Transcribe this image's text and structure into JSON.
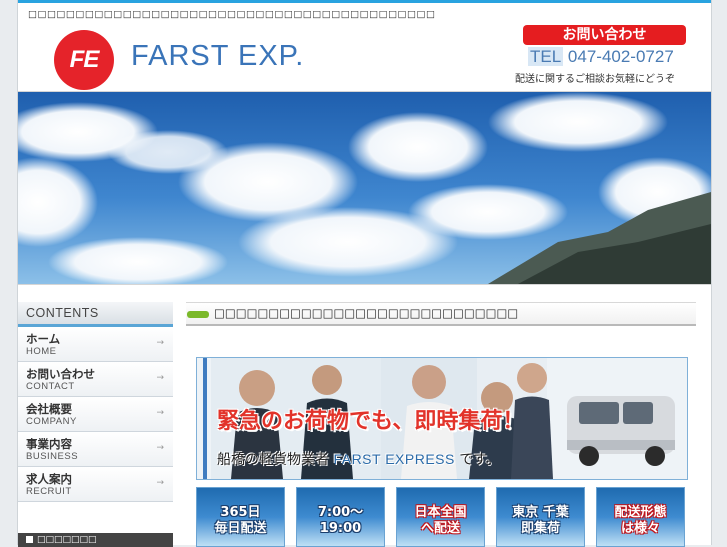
{
  "header": {
    "tagline": "□□□□□□□□□□□□□□□□□□□□□□□□□□□□□□□□□□□□□□□□□□□",
    "logo_mark": "FE",
    "logo_text": "FARST EXP.",
    "contact_button": "お問い合わせ",
    "tel_prefix": "TEL",
    "tel_number": "047-402-0727",
    "contact_note": "配送に関するご相談お気軽にどうぞ"
  },
  "sidebar": {
    "title": "CONTENTS",
    "items": [
      {
        "jp": "ホーム",
        "en": "HOME"
      },
      {
        "jp": "お問い合わせ",
        "en": "CONTACT"
      },
      {
        "jp": "会社概要",
        "en": "COMPANY"
      },
      {
        "jp": "事業内容",
        "en": "BUSINESS"
      },
      {
        "jp": "求人案内",
        "en": "RECRUIT"
      }
    ],
    "arrow": "→",
    "bottom_banner": "□□□□□□□"
  },
  "main": {
    "section_title": "□□□□□□□□□□□□□□□□□□□□□□□□□□□□",
    "banner": {
      "headline": "緊急のお荷物でも、即時集荷！",
      "sub_prefix": "船橋の軽貨物業者",
      "sub_company": "FARST EXPRESS",
      "sub_suffix": "です。"
    },
    "tiles": [
      {
        "line1": "365日",
        "line2": "毎日配送"
      },
      {
        "line1": "7:00～",
        "line2": "19:00"
      },
      {
        "line1": "日本全国",
        "line2": "へ配送"
      },
      {
        "line1": "東京 千葉",
        "line2": "即集荷"
      },
      {
        "line1": "配送形態",
        "line2": "は様々"
      }
    ]
  },
  "colors": {
    "accent_blue": "#29a3e0",
    "logo_red": "#e5232a",
    "brand_blue": "#3a74b8",
    "bullet_green": "#7bb92a"
  }
}
